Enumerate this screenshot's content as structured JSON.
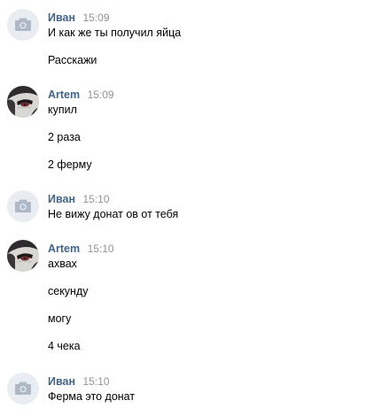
{
  "messages": [
    {
      "author": "Иван",
      "time": "15:09",
      "avatar": "camera-icon",
      "lines": [
        "И как же ты получил яйца",
        "Расскажи"
      ]
    },
    {
      "author": "Artem",
      "time": "15:09",
      "avatar": "anime-avatar",
      "lines": [
        "купил",
        "2 раза",
        "2 ферму"
      ]
    },
    {
      "author": "Иван",
      "time": "15:10",
      "avatar": "camera-icon",
      "lines": [
        "Не вижу донат ов от тебя"
      ]
    },
    {
      "author": "Artem",
      "time": "15:10",
      "avatar": "anime-avatar",
      "lines": [
        "ахвах",
        "секунду",
        "могу",
        "4 чека"
      ]
    },
    {
      "author": "Иван",
      "time": "15:10",
      "avatar": "camera-icon",
      "lines": [
        "Ферма это донат"
      ]
    }
  ],
  "colors": {
    "author": "#42648b",
    "time": "#939393",
    "text": "#000000",
    "camera_avatar_bg": "#e9edf2",
    "camera_icon": "#aeb9c7"
  }
}
